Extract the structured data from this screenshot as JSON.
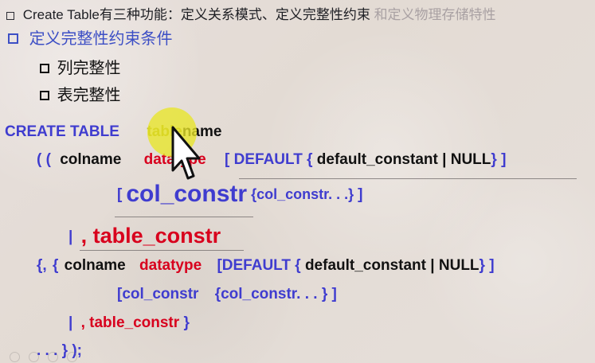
{
  "slide": {
    "top_line": {
      "text_main": "Create Table有三种功能：定义关系模式、定义完整性约束",
      "text_faded": "和定义物理存储特性"
    },
    "main_point": {
      "text": "定义完整性约束条件"
    },
    "sub_points": [
      "列完整性",
      "表完整性"
    ],
    "syntax": {
      "line1": {
        "keyword": "CREATE TABLE",
        "name_highlight": "table",
        "name_rest": "name"
      },
      "line2": {
        "open_parens": "( (",
        "colname": "colname",
        "datatype": "datatype",
        "bracket_open": "[",
        "default_kw": "DEFAULT",
        "brace_open": "{",
        "default_constant": "default_constant",
        "pipe": "|",
        "null_kw": "NULL",
        "brace_close": "}",
        "bracket_close": "]"
      },
      "line3": {
        "bracket_open": "[",
        "col_constr": "col_constr",
        "brace_open": "{",
        "col_constr_repeat": "col_constr. . .",
        "brace_close": "}",
        "bracket_close": "]"
      },
      "line4": {
        "pipe": "|",
        "table_constr": ", table_constr"
      },
      "line5": {
        "comma_brace": "{,",
        "brace_open": "{",
        "colname": "colname",
        "datatype": "datatype",
        "bracket_open": "[DEFAULT",
        "inner_brace_open": "{",
        "default_constant": "default_constant",
        "pipe": "|",
        "null_kw": "NULL",
        "inner_brace_close": "}",
        "bracket_close": "]"
      },
      "line6": {
        "bracket_open": "[col_constr",
        "brace_open": "{col_constr. . .",
        "brace_close": "}",
        "bracket_close": "]"
      },
      "line7": {
        "pipe": "|",
        "table_constr": ", table_constr",
        "brace_close": "}"
      },
      "line8": {
        "ellipsis": ". . . } );"
      }
    },
    "icons": {
      "top_bullet": "square-bullet-icon",
      "blue_bullet": "blue-square-bullet-icon",
      "black_bullet": "black-square-bullet-icon",
      "cursor": "mouse-cursor-icon"
    },
    "colors": {
      "blue": "#3f3ccf",
      "red": "#d8001d",
      "black": "#111111",
      "olive": "#a7a21a",
      "highlight": "#e8e628",
      "faded": "#a9a1a3"
    }
  }
}
